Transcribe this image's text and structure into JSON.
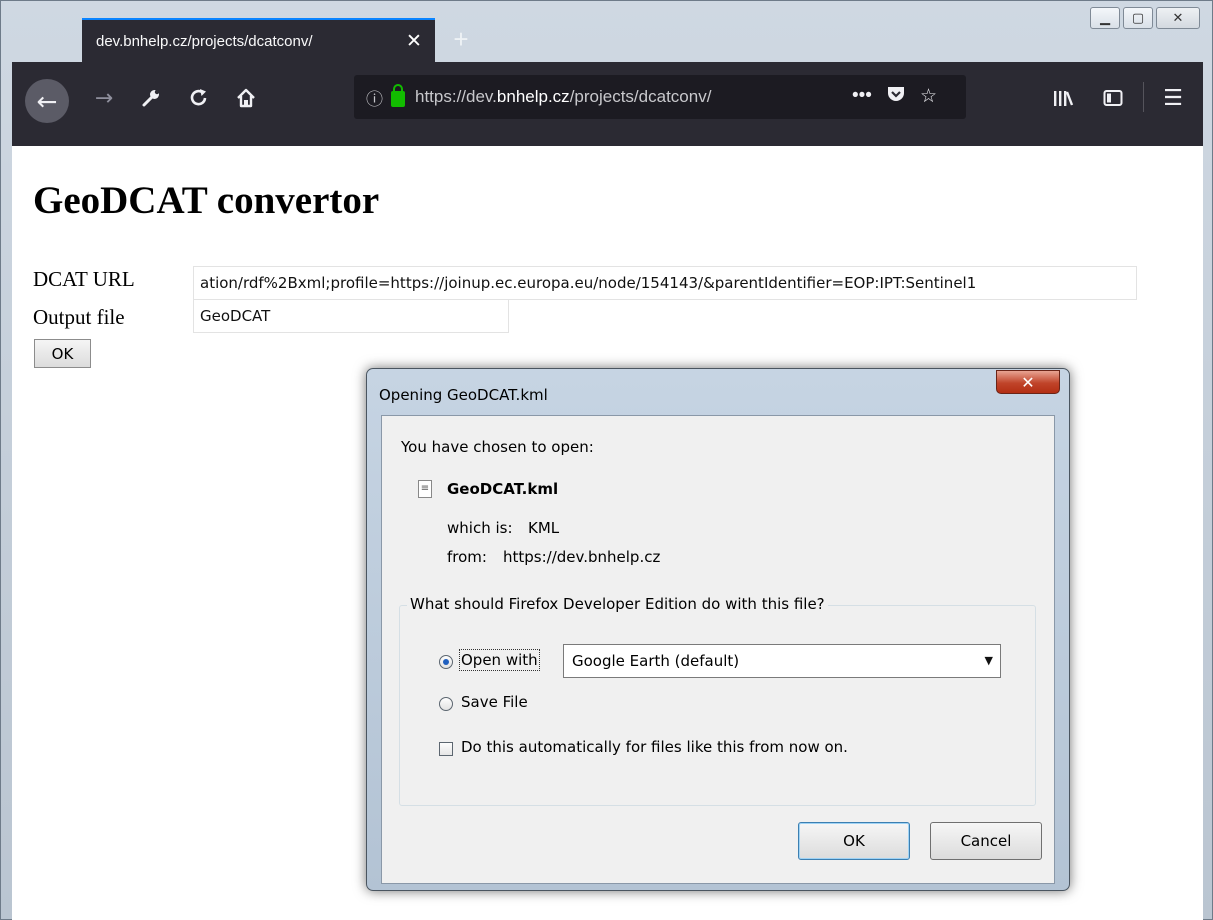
{
  "browser": {
    "tab_title": "dev.bnhelp.cz/projects/dcatconv/",
    "tab_close": "✕",
    "new_tab": "+",
    "url_scheme": "https://dev.",
    "url_host": "bnhelp.cz",
    "url_path": "/projects/dcatconv/",
    "icons": {
      "back": "back-arrow-icon",
      "forward": "forward-arrow-icon",
      "tools": "wrench-icon",
      "reload": "reload-icon",
      "home": "home-icon",
      "info": "info-icon",
      "lock": "lock-icon",
      "more": "more-actions-icon",
      "pocket": "pocket-icon",
      "bookmark": "star-icon",
      "library": "library-icon",
      "sidebar": "sidebar-icon",
      "menu": "hamburger-menu-icon"
    },
    "accent_color": "#0a84ff"
  },
  "page": {
    "title": "GeoDCAT convertor",
    "dcat_url_label": "DCAT URL",
    "dcat_url_value": "ation/rdf%2Bxml;profile=https://joinup.ec.europa.eu/node/154143/&parentIdentifier=EOP:IPT:Sentinel1",
    "output_file_label": "Output file",
    "output_file_value": "GeoDCAT",
    "submit_label": "OK"
  },
  "dialog": {
    "title": "Opening GeoDCAT.kml",
    "intro": "You have chosen to open:",
    "file_name": "GeoDCAT.kml",
    "which_is_label": "which is:",
    "which_is_value": "KML",
    "from_label": "from:",
    "from_value": "https://dev.bnhelp.cz",
    "group_title": "What should Firefox Developer Edition do with this file?",
    "open_with_label": "Open with",
    "open_with_selected": "Google Earth (default)",
    "save_file_label": "Save File",
    "auto_label": "Do this automatically for files like this from now on.",
    "ok_label": "OK",
    "cancel_label": "Cancel",
    "open_with_checked": true,
    "save_file_checked": false,
    "auto_checked": false
  }
}
